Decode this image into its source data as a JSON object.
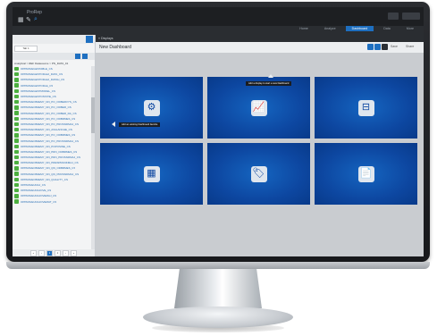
{
  "app": {
    "title": "ProRep"
  },
  "navbar": {
    "items": [
      "Home",
      "Analyze",
      "Dashboard",
      "Data",
      "More"
    ],
    "active_index": 2
  },
  "sidebar": {
    "tab_label": "Tab 1",
    "crumb": "Analytical > REF Datasource > PN_DATA_01",
    "items": [
      "OPPRAVEGESTABLE_CS",
      "OPPRAVEGESTODLEJ_DATA_CS",
      "OPPRAVEGESTODLEJ_DATAH_CS",
      "OPPRAVEGESTODLE_CS",
      "OPPRAVEGESTMODEL_CS",
      "OPPRAVEGESTOSTATE_CS",
      "OPPRAVEOBJEMY_NN_PO_ODBERVYS_CS",
      "OPPRAVEOBJEMY_NN_PO_ODBER_CS",
      "OPPRAVEOBJEMY_NN_PO_ODBER_DA_CS",
      "OPPRAVEOBJEMY_NN_PO_ODBRMES_CS",
      "OPPRAVEOBJEMY_NN_PO_PROSNDMAJ_CS",
      "OPPRAVEOBJEMY_NN_AVALANCHE_CS",
      "OPPRAVEOBJEMY_NN_PO_ODBRMES_CS",
      "OPPRAVEOBJEMY_NN_PO_PROSNDMAJ_CS",
      "OPPRAVEOBJEMY_NN_POPOSINE_CS",
      "OPPRAVEOBJEMY_NN_PRN_ODBRMES_CS",
      "OPPRAVEOBJEMY_NN_PRN_PROSNDMAJ_CS",
      "OPPRAVEOBJEMY_NN_PRESPRANKMAJ_CS",
      "OPPRAVEOBJEMY_NN_QN_ODBRMES_CS",
      "OPPRAVEOBJEMY_NN_QN_PROSNDMAJ_CS",
      "OPPRAVEOBJEMY_NN_QUALITY_CS",
      "OPPRAVEUDAJ_CS",
      "OPPRAVEUDAJOVE_CS",
      "OPPRAVEUDAJOVEMAJ_CS",
      "OPPRAVEUDAJOVEMAT_CS"
    ],
    "pager": [
      "«",
      "‹",
      "1",
      "2",
      "›",
      "»"
    ],
    "pager_active": 2
  },
  "main": {
    "crumb": "« Displays",
    "dashboard_title": "New Dashboard",
    "toolbar_labels": [
      "Save",
      "Share"
    ],
    "tooltips": {
      "top": "Add a display to start a new Dashboard",
      "left": "Add an existing Dashboard favorite"
    },
    "tiles": [
      {
        "icon_name": "custom-widget-icon",
        "glyph": "⚙"
      },
      {
        "icon_name": "chart-icon",
        "glyph": "📈"
      },
      {
        "icon_name": "filter-panel-icon",
        "glyph": "⊟"
      },
      {
        "icon_name": "table-icon",
        "glyph": "▦"
      },
      {
        "icon_name": "tag-icon",
        "glyph": "🏷"
      },
      {
        "icon_name": "document-icon",
        "glyph": "📄"
      }
    ]
  },
  "colors": {
    "accent": "#1e6fc0",
    "tile": "#0d47a1",
    "list_icon": "#4caf3f"
  }
}
